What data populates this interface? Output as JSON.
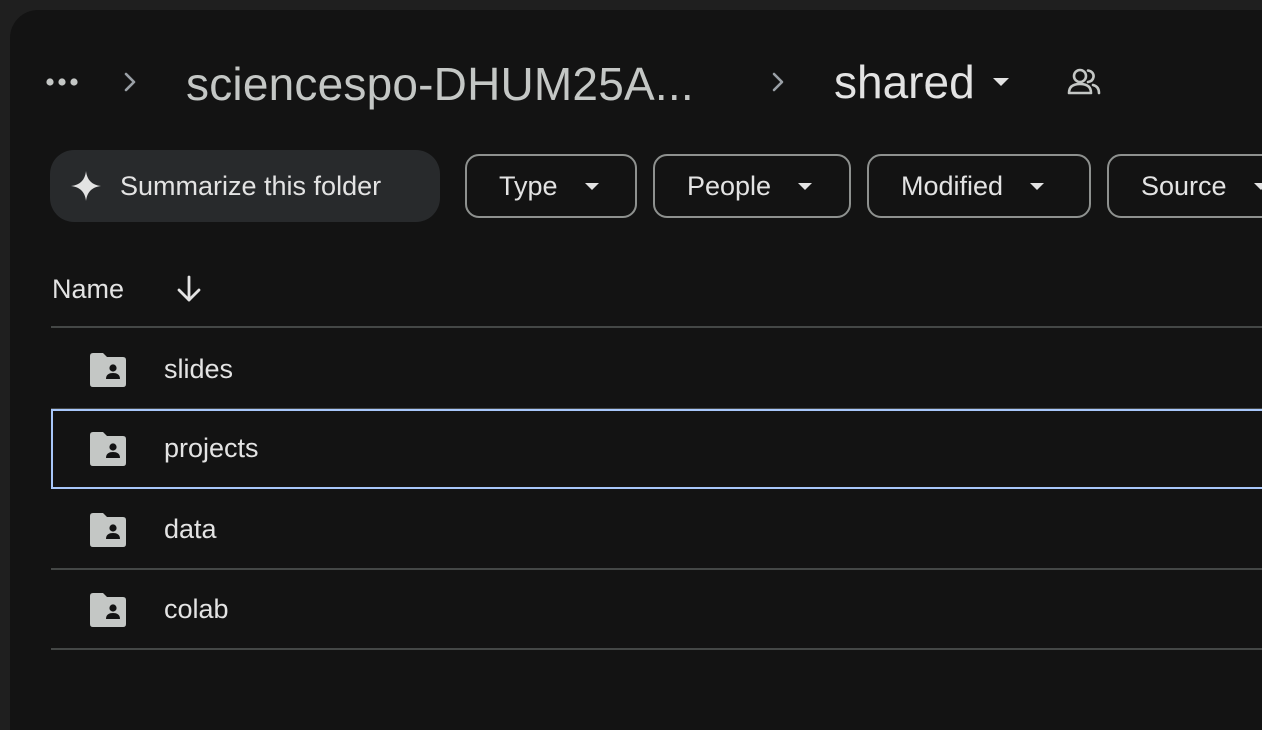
{
  "breadcrumb": {
    "more_icon": "more-horiz-icon",
    "separator_icon": "chevron-right-icon",
    "parent_folder": "sciencespo-DHUM25A...",
    "current_folder": "shared",
    "current_dropdown_icon": "arrow-drop-down-icon",
    "shared_icon": "people-icon"
  },
  "toolbar": {
    "summarize_label": "Summarize this folder",
    "summarize_icon": "sparkle-icon",
    "filters": [
      {
        "label": "Type"
      },
      {
        "label": "People"
      },
      {
        "label": "Modified"
      },
      {
        "label": "Source"
      }
    ]
  },
  "list": {
    "name_header": "Name",
    "sort_icon": "arrow-downward-icon",
    "items": [
      {
        "name": "slides",
        "icon": "shared-folder-icon",
        "selected": false
      },
      {
        "name": "projects",
        "icon": "shared-folder-icon",
        "selected": true
      },
      {
        "name": "data",
        "icon": "shared-folder-icon",
        "selected": false
      },
      {
        "name": "colab",
        "icon": "shared-folder-icon",
        "selected": false
      }
    ]
  },
  "colors": {
    "background": "#131313",
    "accent_selection": "#a8c7fa",
    "text": "#e3e3e3"
  }
}
